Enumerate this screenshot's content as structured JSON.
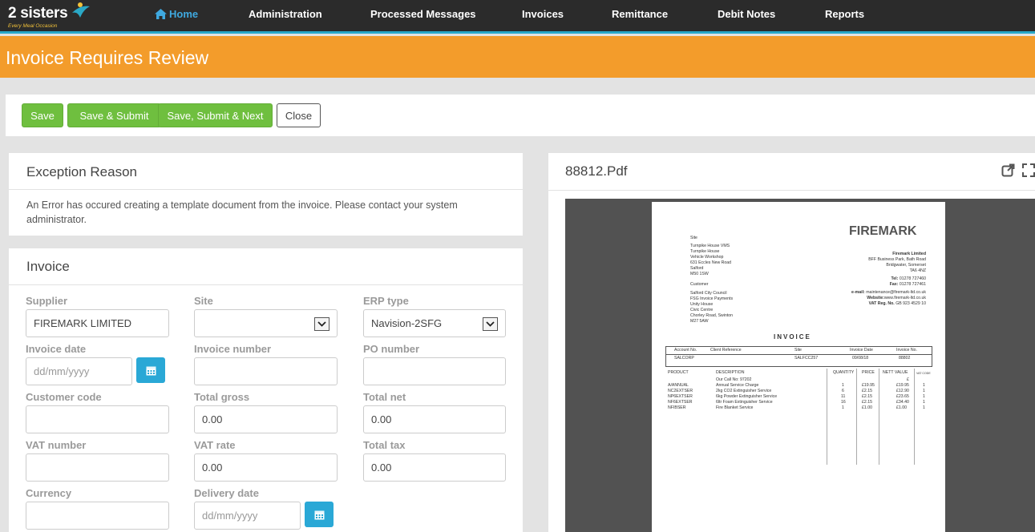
{
  "brand": {
    "name": "2 sisters",
    "tagline": "Every Meal Occasion"
  },
  "nav": {
    "home": "Home",
    "items": [
      "Administration",
      "Processed Messages",
      "Invoices",
      "Remittance",
      "Debit Notes",
      "Reports"
    ]
  },
  "page_title": "Invoice Requires Review",
  "toolbar": {
    "save": "Save",
    "save_submit": "Save & Submit",
    "save_submit_next": "Save, Submit & Next",
    "close": "Close"
  },
  "exception": {
    "title": "Exception Reason",
    "message": "An Error has occured creating a template document from the invoice. Please contact your system administrator."
  },
  "invoice": {
    "title": "Invoice",
    "supplier_label": "Supplier",
    "supplier_value": "FIREMARK LIMITED",
    "site_label": "Site",
    "site_value": "",
    "erp_label": "ERP type",
    "erp_value": "Navision-2SFG",
    "invoice_date_label": "Invoice date",
    "invoice_date_placeholder": "dd/mm/yyyy",
    "invoice_number_label": "Invoice number",
    "invoice_number_value": "",
    "po_label": "PO number",
    "po_value": "",
    "customer_code_label": "Customer code",
    "customer_code_value": "",
    "total_gross_label": "Total gross",
    "total_gross_value": "0.00",
    "total_net_label": "Total net",
    "total_net_value": "0.00",
    "vat_number_label": "VAT number",
    "vat_number_value": "",
    "vat_rate_label": "VAT rate",
    "vat_rate_value": "0.00",
    "total_tax_label": "Total tax",
    "total_tax_value": "0.00",
    "currency_label": "Currency",
    "currency_value": "",
    "delivery_date_label": "Delivery date",
    "delivery_date_placeholder": "dd/mm/yyyy"
  },
  "pdf": {
    "filename": "88812.Pdf",
    "doc": {
      "logo": "FIREMARK",
      "site_label": "Site",
      "site_lines": [
        "Turnpike House VMS",
        "Turnpike House",
        "Vehicle Workshop",
        "631 Eccles New Road",
        "Salford",
        "M50 1SW"
      ],
      "customer_label": "Customer",
      "customer_lines": [
        "Salford City Council",
        "FSG Invoice Payments",
        "Unity House",
        "Civic Centre",
        "Chorley Road, Swinton",
        "M27 5AW"
      ],
      "company_lines": [
        "Firemark Limited",
        "BFF Business Park, Bath Road",
        "Bridgwater,  Somerset",
        "TA6 4NZ"
      ],
      "tel_label": "Tel:",
      "tel": "01278 727460",
      "fax_label": "Fax:",
      "fax": "01278 727461",
      "email_label": "e-mail:",
      "email": "maintenance@firemark-ltd.co.uk",
      "web_label": "Website:",
      "web": "www.firemark-ltd.co.uk",
      "vat_label": "VAT Reg. No.",
      "vat": "GB 923 4529 10",
      "heading": "INVOICE",
      "acct_headers": [
        "Account No.",
        "Client Reference",
        "Site",
        "Invoice Date",
        "Invoice No."
      ],
      "acct_values": [
        "SALCORP",
        "",
        "SALFCC257",
        "09/08/18",
        "88802"
      ],
      "line_headers": [
        "PRODUCT",
        "DESCRIPTION",
        "QUANTITY",
        "PRICE",
        "NETT VALUE",
        "VAT CODE"
      ],
      "call_no": "Our Call No:  97202",
      "call_currency": "£",
      "lines": [
        {
          "product": "A/ANNUAL",
          "desc": "Annual Service Charge",
          "qty": "1",
          "price": "£19.95",
          "net": "£19.95",
          "vat": "1"
        },
        {
          "product": "NC2EXTSER",
          "desc": "2kg CO2 Extinguisher Service",
          "qty": "6",
          "price": "£2.15",
          "net": "£12.90",
          "vat": "1"
        },
        {
          "product": "NP6EXTSER",
          "desc": "6kg Powder Extinguisher Service",
          "qty": "11",
          "price": "£2.15",
          "net": "£23.65",
          "vat": "1"
        },
        {
          "product": "NF6EXTSER",
          "desc": "6ltr Foam Extinguisher Service",
          "qty": "16",
          "price": "£2.15",
          "net": "£34.40",
          "vat": "1"
        },
        {
          "product": "NFIBSER",
          "desc": "Fire Blanket Service",
          "qty": "1",
          "price": "£1.00",
          "net": "£1.00",
          "vat": "1"
        }
      ]
    }
  },
  "colors": {
    "accent_orange": "#f39c2b",
    "accent_blue": "#2aa8d6",
    "green": "#6fbf3f",
    "navbar": "#2b2b2b"
  }
}
